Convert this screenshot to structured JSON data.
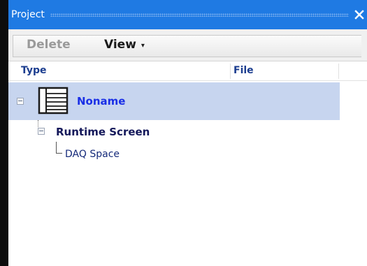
{
  "panel": {
    "title": "Project",
    "close_glyph": "✕"
  },
  "toolbar": {
    "delete_label": "Delete",
    "view_label": "View",
    "view_caret": "▾"
  },
  "columns": {
    "type": "Type",
    "file": "File"
  },
  "tree": {
    "root": {
      "label": "Noname",
      "icon": "project-list-icon"
    },
    "child": {
      "label": "Runtime Screen"
    },
    "grandchild": {
      "label": "DAQ Space"
    }
  },
  "colors": {
    "title_bar": "#1f7ae3",
    "selection": "#c7d5ef",
    "root_text": "#1a2fe6"
  }
}
